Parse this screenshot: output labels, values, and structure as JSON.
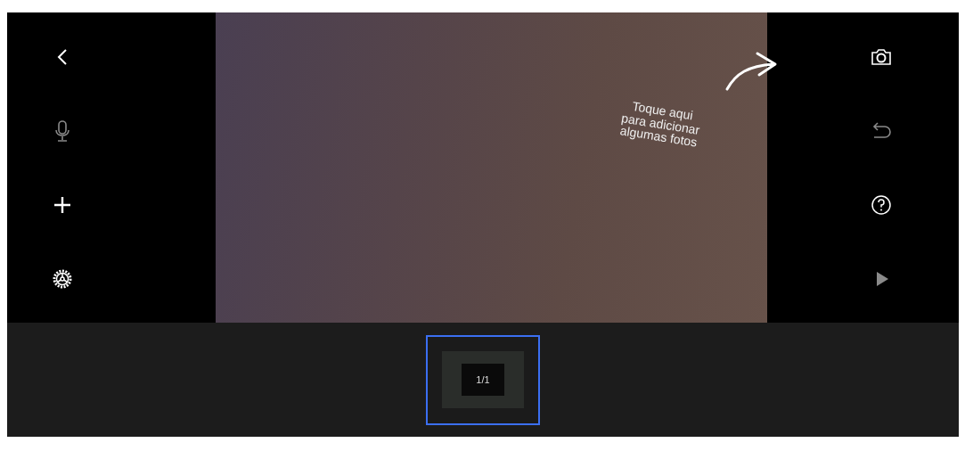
{
  "left_toolbar": [
    {
      "kind": "back",
      "disabled": false
    },
    {
      "kind": "microphone",
      "disabled": true
    },
    {
      "kind": "add",
      "disabled": false
    },
    {
      "kind": "settings",
      "disabled": false
    }
  ],
  "right_toolbar": [
    {
      "kind": "camera",
      "disabled": false
    },
    {
      "kind": "undo",
      "disabled": true
    },
    {
      "kind": "help",
      "disabled": false
    },
    {
      "kind": "play",
      "disabled": true
    }
  ],
  "hint": {
    "lines": [
      "Toque aqui",
      "para adicionar",
      "algumas fotos"
    ]
  },
  "thumbnails": [
    {
      "label": "1/1",
      "selected": true
    }
  ]
}
